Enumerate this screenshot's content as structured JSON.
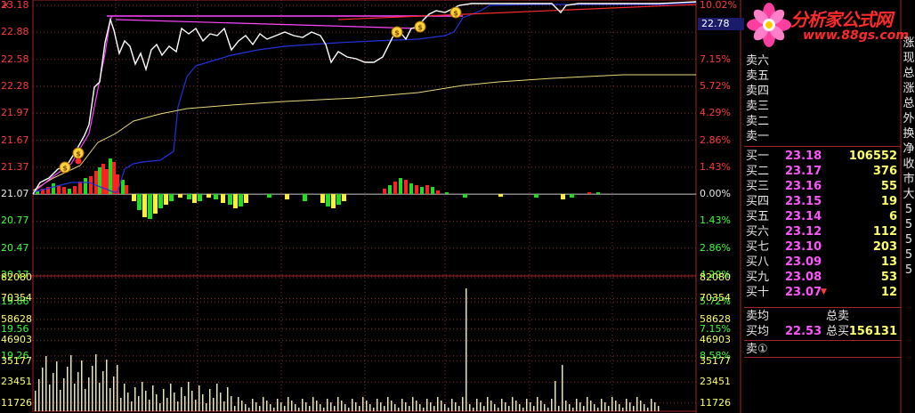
{
  "window": {
    "close_glyph": "×"
  },
  "price_axis": {
    "left_labels": [
      "23.18",
      "22.88",
      "22.58",
      "22.28",
      "21.97",
      "21.67",
      "21.37",
      "21.07",
      "20.77",
      "20.47",
      "20.17",
      "19.86",
      "19.56",
      "19.26"
    ],
    "right_labels": [
      "10.02%",
      "",
      "7.15%",
      "5.72%",
      "4.29%",
      "2.86%",
      "1.43%",
      "0.00%",
      "1.43%",
      "2.86%",
      "4.29%",
      "5.72%",
      "7.15%",
      "8.58%"
    ],
    "current_price_tag": "22.78"
  },
  "volume_axis": {
    "labels": [
      "82080",
      "70354",
      "58628",
      "46903",
      "35177",
      "23451",
      "11726"
    ]
  },
  "logo": {
    "title": "分析家公式网",
    "url": "www.88gs.com"
  },
  "order_book": {
    "sell": [
      {
        "label": "卖六"
      },
      {
        "label": "卖五"
      },
      {
        "label": "卖四"
      },
      {
        "label": "卖三"
      },
      {
        "label": "卖二"
      },
      {
        "label": "卖一"
      }
    ],
    "buy": [
      {
        "label": "买一",
        "price": "23.18",
        "volume": "106552"
      },
      {
        "label": "买二",
        "price": "23.17",
        "volume": "376"
      },
      {
        "label": "买三",
        "price": "23.16",
        "volume": "55"
      },
      {
        "label": "买四",
        "price": "23.15",
        "volume": "19"
      },
      {
        "label": "买五",
        "price": "23.14",
        "volume": "6"
      },
      {
        "label": "买六",
        "price": "23.12",
        "volume": "112"
      },
      {
        "label": "买七",
        "price": "23.10",
        "volume": "203"
      },
      {
        "label": "买八",
        "price": "23.09",
        "volume": "13"
      },
      {
        "label": "买九",
        "price": "23.08",
        "volume": "53"
      },
      {
        "label": "买十",
        "price": "23.07",
        "volume": "12"
      }
    ],
    "sell_avg_label": "卖均",
    "total_sell_label": "总卖",
    "buy_avg_label": "买均",
    "buy_avg_price": "22.53",
    "total_buy_label": "总买",
    "total_buy_value": "156131",
    "sell_one_label": "卖①",
    "down_arrow": "▼"
  },
  "side_column": [
    "涨",
    "现",
    "总",
    "涨",
    "总",
    "外",
    "换",
    "净",
    "收",
    "市",
    "大",
    "5",
    "5",
    "5",
    "5",
    "5"
  ],
  "colors": {
    "price_line": "#ffffff",
    "avg_line": "#e8d878",
    "blue_line": "#2233dd",
    "magenta_line": "#ff44ff",
    "red_line": "#ff2a2a",
    "grid": "#8a2a2a",
    "up_bar": "#ff2222",
    "down_bar": "#22dd22",
    "yellow_bar": "#ffee33"
  },
  "icons": {
    "money_bag": "money-bag-icon",
    "flower_logo": "flower-logo-icon"
  }
}
